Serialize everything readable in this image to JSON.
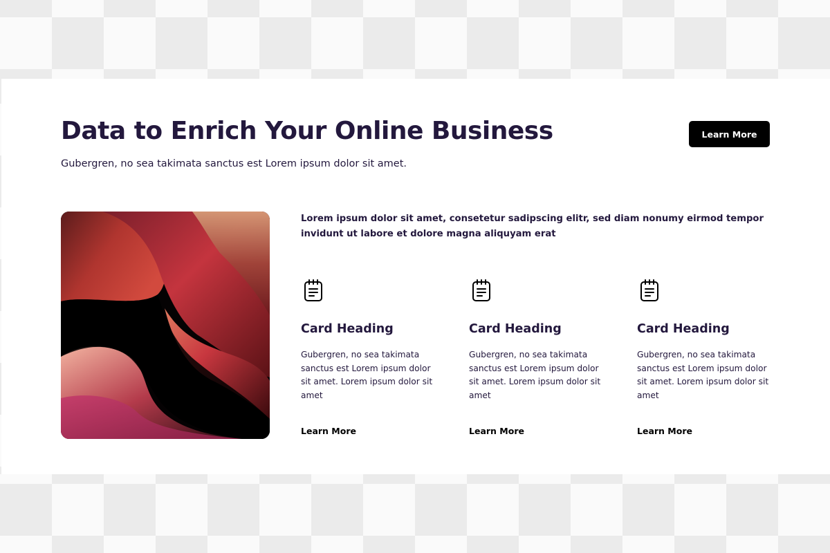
{
  "header": {
    "title": "Data to Enrich Your Online Business",
    "subtitle": "Gubergren, no sea takimata sanctus est Lorem ipsum dolor sit amet.",
    "button_label": "Learn More"
  },
  "intro": {
    "text": "Lorem ipsum dolor sit amet, consetetur sadipscing elitr, sed diam nonumy eirmod tempor invidunt ut labore et dolore magna aliquyam erat"
  },
  "cards": [
    {
      "icon": "notepad-icon",
      "heading": "Card Heading",
      "text": "Gubergren, no sea takimata sanctus est Lorem ipsum dolor sit amet. Lorem ipsum dolor sit amet",
      "link_label": "Learn More"
    },
    {
      "icon": "notepad-icon",
      "heading": "Card Heading",
      "text": "Gubergren, no sea takimata sanctus est Lorem ipsum dolor sit amet. Lorem ipsum dolor sit amet",
      "link_label": "Learn More"
    },
    {
      "icon": "notepad-icon",
      "heading": "Card Heading",
      "text": "Gubergren, no sea takimata sanctus est Lorem ipsum dolor sit amet. Lorem ipsum dolor sit amet",
      "link_label": "Learn More"
    }
  ],
  "colors": {
    "heading": "#23183d",
    "button_bg": "#000000",
    "button_text": "#ffffff",
    "section_bg": "#ffffff",
    "canvas_checker_light": "#fafafa",
    "canvas_checker_dark": "#ebebeb"
  }
}
